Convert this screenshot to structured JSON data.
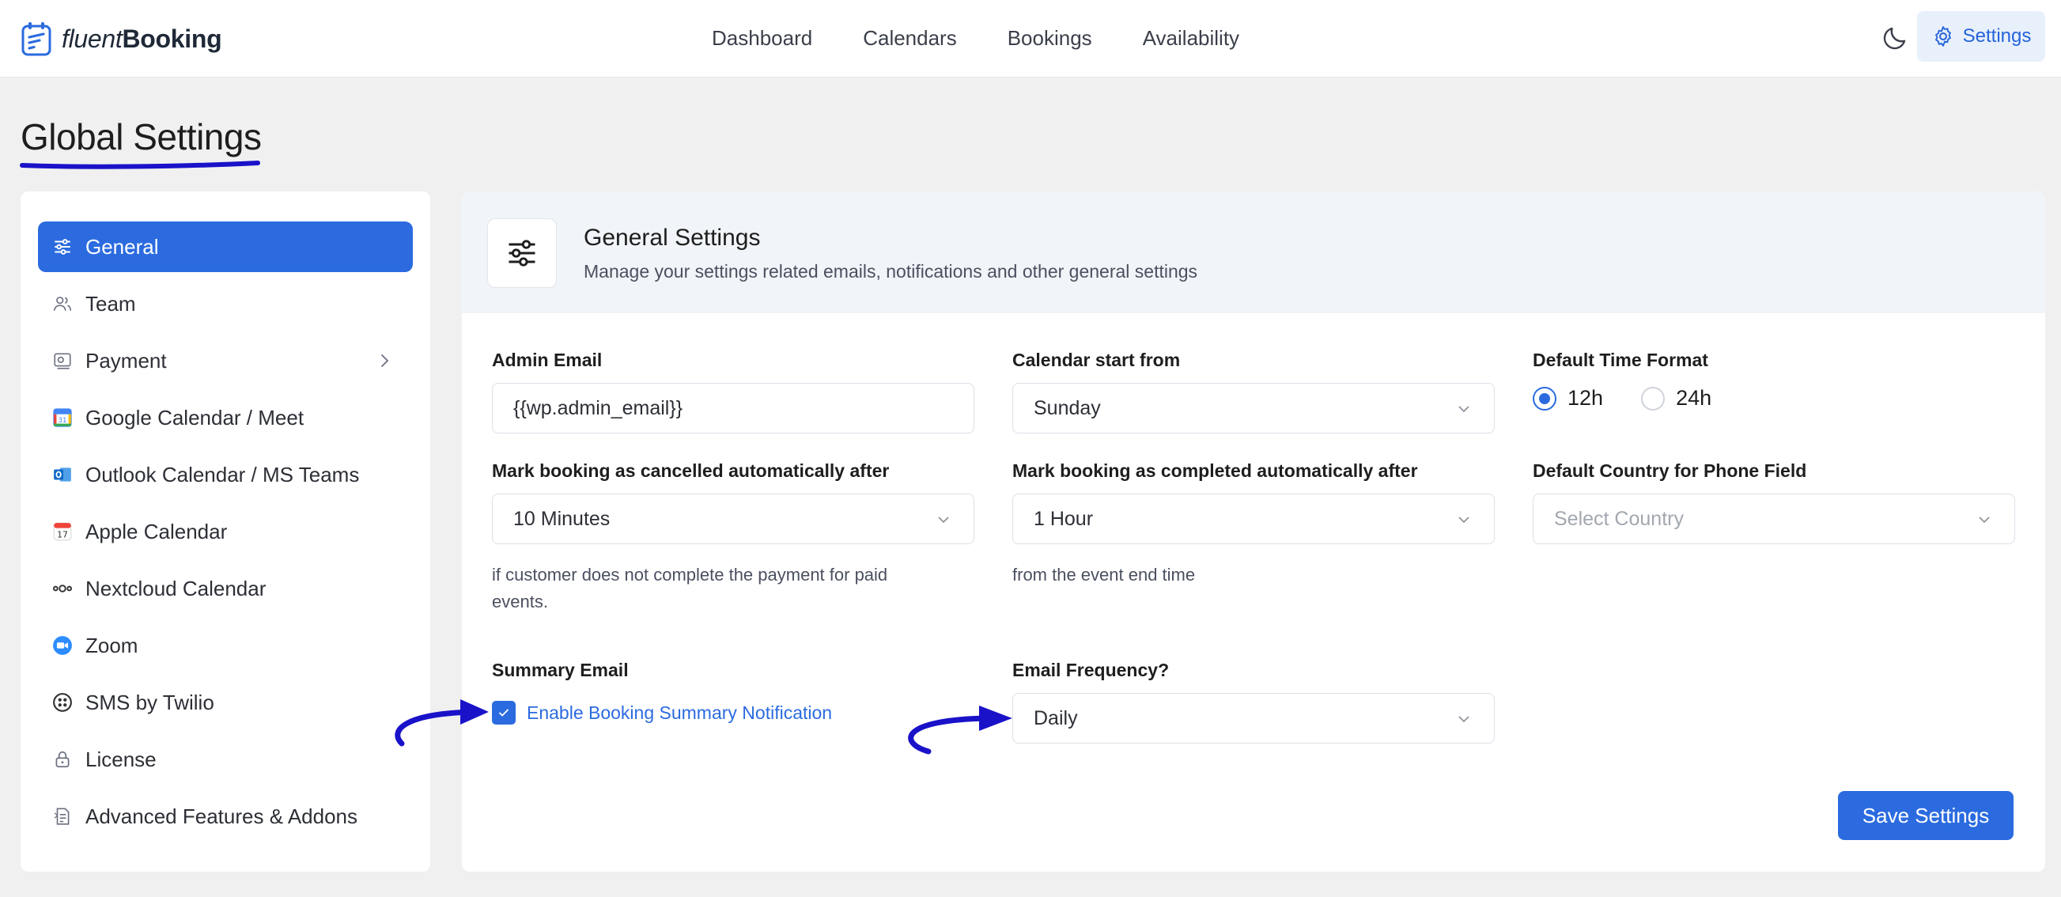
{
  "app": {
    "brand_light": "fluent",
    "brand_bold": "Booking"
  },
  "nav": {
    "items": [
      "Dashboard",
      "Calendars",
      "Bookings",
      "Availability"
    ],
    "settings_label": "Settings"
  },
  "page": {
    "title": "Global Settings"
  },
  "sidebar": {
    "items": [
      {
        "label": "General",
        "icon": "sliders-icon",
        "active": true
      },
      {
        "label": "Team",
        "icon": "users-icon"
      },
      {
        "label": "Payment",
        "icon": "payment-icon",
        "has_submenu": true
      },
      {
        "label": "Google Calendar / Meet",
        "icon": "google-calendar-icon"
      },
      {
        "label": "Outlook Calendar / MS Teams",
        "icon": "outlook-icon"
      },
      {
        "label": "Apple Calendar",
        "icon": "apple-calendar-icon"
      },
      {
        "label": "Nextcloud Calendar",
        "icon": "nextcloud-icon"
      },
      {
        "label": "Zoom",
        "icon": "zoom-icon"
      },
      {
        "label": "SMS by Twilio",
        "icon": "twilio-icon"
      },
      {
        "label": "License",
        "icon": "lock-icon"
      },
      {
        "label": "Advanced Features & Addons",
        "icon": "addons-icon"
      }
    ]
  },
  "panel": {
    "title": "General Settings",
    "subtitle": "Manage your settings related emails, notifications and other general settings",
    "admin_email": {
      "label": "Admin Email",
      "value": "{{wp.admin_email}}"
    },
    "calendar_start": {
      "label": "Calendar start from",
      "value": "Sunday"
    },
    "time_format": {
      "label": "Default Time Format",
      "options": [
        "12h",
        "24h"
      ],
      "selected": "12h"
    },
    "auto_cancel": {
      "label": "Mark booking as cancelled automatically after",
      "value": "10 Minutes",
      "help": "if customer does not complete the payment for paid events."
    },
    "auto_complete": {
      "label": "Mark booking as completed automatically after",
      "value": "1 Hour",
      "help": "from the event end time"
    },
    "phone_country": {
      "label": "Default Country for Phone Field",
      "placeholder": "Select Country"
    },
    "summary_email": {
      "label": "Summary Email",
      "checkbox_label": "Enable Booking Summary Notification",
      "checked": true
    },
    "email_frequency": {
      "label": "Email Frequency?",
      "value": "Daily"
    },
    "save_label": "Save Settings"
  },
  "colors": {
    "accent": "#2b6bdf",
    "annotation": "#1a12c9"
  }
}
